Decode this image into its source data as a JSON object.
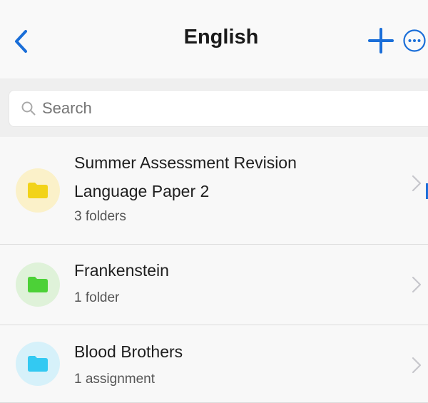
{
  "nav": {
    "title": "English",
    "accent_color": "#1a6ed8",
    "back_icon": "chevron-left-icon",
    "add_icon": "plus-icon",
    "more_icon": "ellipsis-circle-icon"
  },
  "search": {
    "placeholder": "Search",
    "value": ""
  },
  "items": [
    {
      "title": "Summer Assessment Revision Language Paper 2",
      "title_line1": "Summer Assessment Revision",
      "title_line2": "Language Paper 2",
      "subtitle": "3 folders",
      "folder_color": "#f2d318",
      "circle_color": "#fbf1c9",
      "icon": "folder-icon"
    },
    {
      "title": "Frankenstein",
      "subtitle": "1 folder",
      "folder_color": "#4cd137",
      "circle_color": "#dff2d9",
      "icon": "folder-icon"
    },
    {
      "title": "Blood Brothers",
      "subtitle": "1 assignment",
      "folder_color": "#33c9f2",
      "circle_color": "#d6f1fa",
      "icon": "folder-icon"
    }
  ]
}
